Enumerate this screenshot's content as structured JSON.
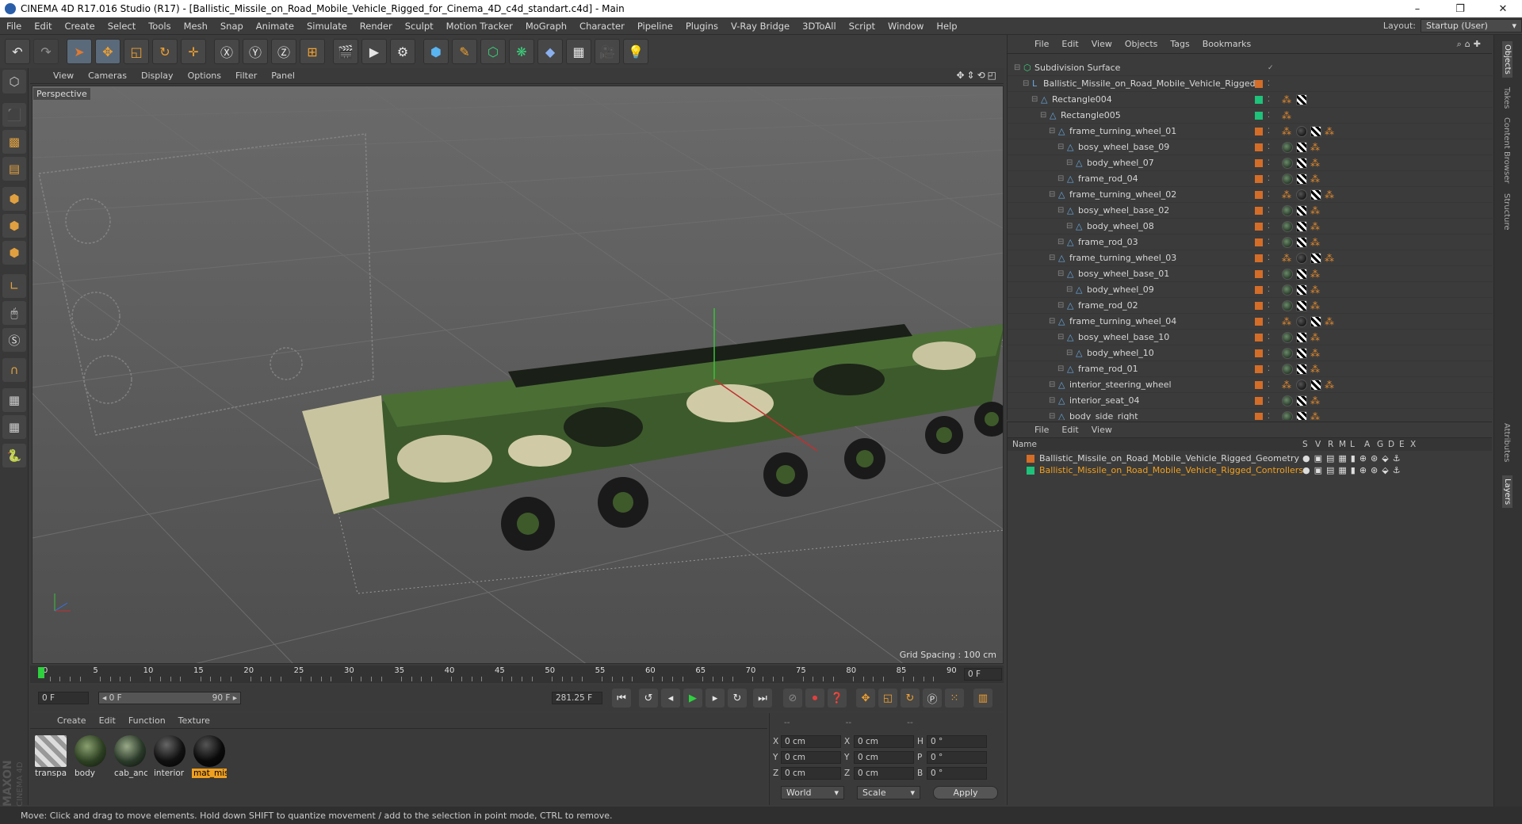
{
  "window": {
    "title": "CINEMA 4D R17.016 Studio (R17) - [Ballistic_Missile_on_Road_Mobile_Vehicle_Rigged_for_Cinema_4D_c4d_standart.c4d] - Main",
    "min": "–",
    "max": "❐",
    "close": "✕"
  },
  "menu": [
    "File",
    "Edit",
    "Create",
    "Select",
    "Tools",
    "Mesh",
    "Snap",
    "Animate",
    "Simulate",
    "Render",
    "Sculpt",
    "Motion Tracker",
    "MoGraph",
    "Character",
    "Pipeline",
    "Plugins",
    "V-Ray Bridge",
    "3DToAll",
    "Script",
    "Window",
    "Help"
  ],
  "layout": {
    "label": "Layout:",
    "value": "Startup (User)"
  },
  "viewport": {
    "menu": [
      "View",
      "Cameras",
      "Display",
      "Options",
      "Filter",
      "Panel"
    ],
    "camera_label": "Perspective",
    "grid_spacing": "Grid Spacing : 100 cm"
  },
  "timeline": {
    "ticks": [
      "0",
      "5",
      "10",
      "15",
      "20",
      "25",
      "30",
      "35",
      "40",
      "45",
      "50",
      "55",
      "60",
      "65",
      "70",
      "75",
      "80",
      "85",
      "90"
    ],
    "current_frame": "0 F",
    "start_field": "0 F",
    "range_start": "◂ 0 F",
    "range_end": "90 F ▸",
    "fps_field": "281.25 F"
  },
  "material_manager": {
    "menu": [
      "Create",
      "Edit",
      "Function",
      "Texture"
    ],
    "materials": [
      {
        "label": "transpa",
        "kind": "transparent"
      },
      {
        "label": "body",
        "kind": "camo"
      },
      {
        "label": "cab_anc",
        "kind": "camo-dark"
      },
      {
        "label": "interior",
        "kind": "black"
      },
      {
        "label": "mat_mis",
        "kind": "black-selected"
      }
    ]
  },
  "coordinates": {
    "header": [
      "--",
      "--",
      "--"
    ],
    "rows": [
      {
        "a": "X",
        "av": "0 cm",
        "b": "X",
        "bv": "0 cm",
        "c": "H",
        "cv": "0 °"
      },
      {
        "a": "Y",
        "av": "0 cm",
        "b": "Y",
        "bv": "0 cm",
        "c": "P",
        "cv": "0 °"
      },
      {
        "a": "Z",
        "av": "0 cm",
        "b": "Z",
        "bv": "0 cm",
        "c": "B",
        "cv": "0 °"
      }
    ],
    "world": "World",
    "scale": "Scale",
    "apply": "Apply"
  },
  "object_manager": {
    "menu": [
      "File",
      "Edit",
      "View",
      "Objects",
      "Tags",
      "Bookmarks"
    ],
    "objects": [
      {
        "name": "Subdivision Surface",
        "indent": 0,
        "layer": "none"
      },
      {
        "name": "Ballistic_Missile_on_Road_Mobile_Vehicle_Rigged",
        "indent": 1,
        "layer": "orange"
      },
      {
        "name": "Rectangle004",
        "indent": 2,
        "layer": "green"
      },
      {
        "name": "Rectangle005",
        "indent": 3,
        "layer": "green"
      },
      {
        "name": "frame_turning_wheel_01",
        "indent": 4,
        "layer": "orange"
      },
      {
        "name": "bosy_wheel_base_09",
        "indent": 5,
        "layer": "orange"
      },
      {
        "name": "body_wheel_07",
        "indent": 6,
        "layer": "orange"
      },
      {
        "name": "frame_rod_04",
        "indent": 5,
        "layer": "orange"
      },
      {
        "name": "frame_turning_wheel_02",
        "indent": 4,
        "layer": "orange"
      },
      {
        "name": "bosy_wheel_base_02",
        "indent": 5,
        "layer": "orange"
      },
      {
        "name": "body_wheel_08",
        "indent": 6,
        "layer": "orange"
      },
      {
        "name": "frame_rod_03",
        "indent": 5,
        "layer": "orange"
      },
      {
        "name": "frame_turning_wheel_03",
        "indent": 4,
        "layer": "orange"
      },
      {
        "name": "bosy_wheel_base_01",
        "indent": 5,
        "layer": "orange"
      },
      {
        "name": "body_wheel_09",
        "indent": 6,
        "layer": "orange"
      },
      {
        "name": "frame_rod_02",
        "indent": 5,
        "layer": "orange"
      },
      {
        "name": "frame_turning_wheel_04",
        "indent": 4,
        "layer": "orange"
      },
      {
        "name": "bosy_wheel_base_10",
        "indent": 5,
        "layer": "orange"
      },
      {
        "name": "body_wheel_10",
        "indent": 6,
        "layer": "orange"
      },
      {
        "name": "frame_rod_01",
        "indent": 5,
        "layer": "orange"
      },
      {
        "name": "interior_steering_wheel",
        "indent": 4,
        "layer": "orange"
      },
      {
        "name": "interior_seat_04",
        "indent": 4,
        "layer": "orange"
      },
      {
        "name": "body_side_right",
        "indent": 4,
        "layer": "orange"
      }
    ]
  },
  "layer_manager": {
    "menu": [
      "File",
      "Edit",
      "View"
    ],
    "columns": [
      "Name",
      "S",
      "V",
      "R",
      "M",
      "L",
      "A",
      "G",
      "D",
      "E",
      "X"
    ],
    "layers": [
      {
        "name": "Ballistic_Missile_on_Road_Mobile_Vehicle_Rigged_Geometry",
        "color": "#d46d28",
        "text_color": "#d6d6d6"
      },
      {
        "name": "Ballistic_Missile_on_Road_Mobile_Vehicle_Rigged_Controllers",
        "color": "#1ec27a",
        "text_color": "#f0a020"
      }
    ]
  },
  "right_tabs": [
    "Objects",
    "Takes",
    "Content Browser",
    "Structure",
    "Attributes",
    "Layers"
  ],
  "status": "Move: Click and drag to move elements. Hold down SHIFT to quantize movement / add to the selection in point mode, CTRL to remove.",
  "branding": {
    "maxon": "MAXON",
    "c4d": "CINEMA 4D"
  }
}
